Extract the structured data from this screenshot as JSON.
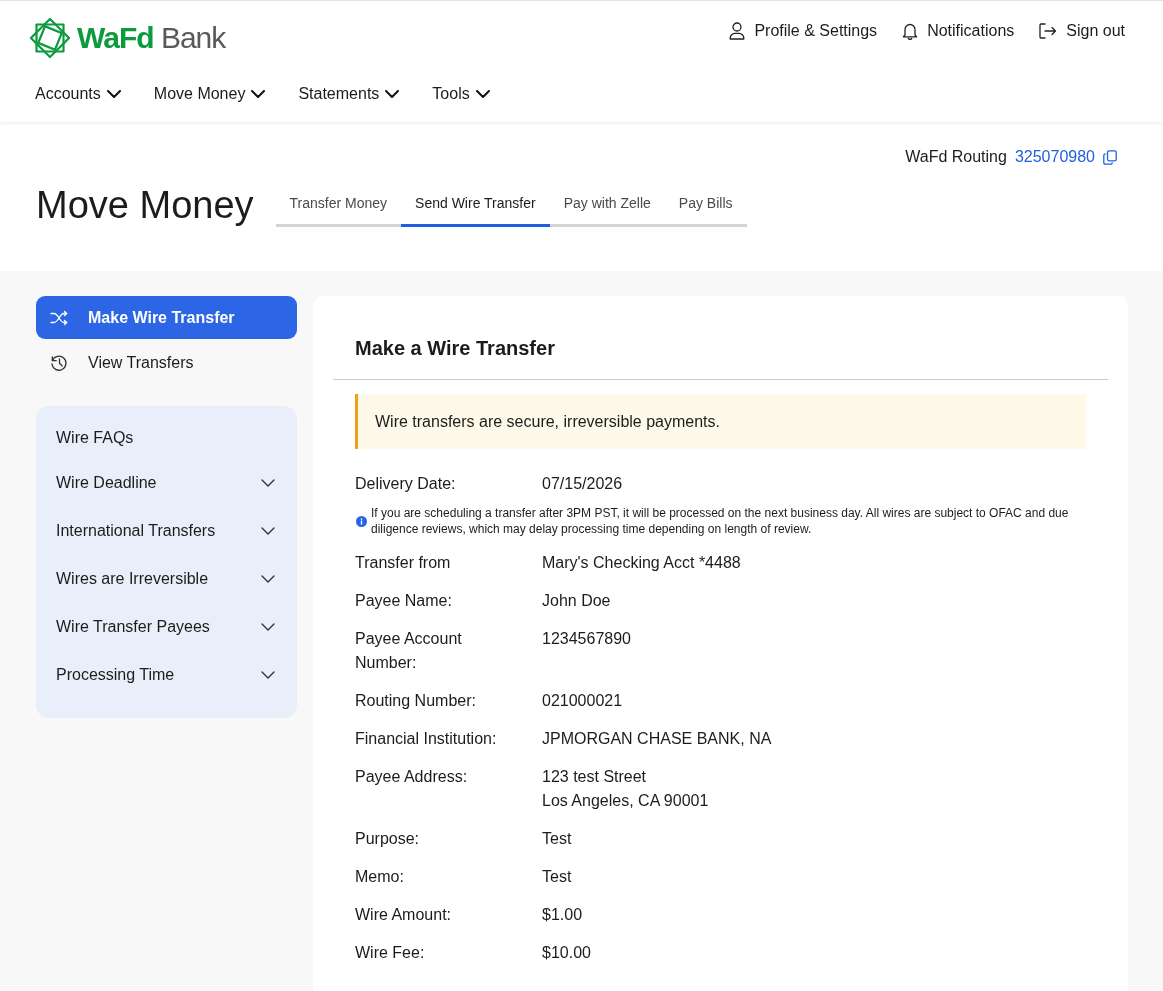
{
  "header": {
    "brand": "**WaFd** Bank",
    "links": [
      {
        "label": "Profile & Settings"
      },
      {
        "label": "Notifications"
      },
      {
        "label": "Sign out"
      }
    ],
    "nav": [
      {
        "label": "Accounts",
        "expanded": false
      },
      {
        "label": "Move Money",
        "expanded": false
      },
      {
        "label": "Statements",
        "expanded": false
      },
      {
        "label": "Tools",
        "expanded": false
      }
    ]
  },
  "routing": {
    "label": "WaFd Routing",
    "number": "325070980"
  },
  "page_title": "Move Money",
  "tabs": [
    {
      "label": "Transfer Money",
      "selected": false
    },
    {
      "label": "Send Wire Transfer",
      "selected": true
    },
    {
      "label": "Pay with Zelle",
      "selected": false
    },
    {
      "label": "Pay Bills",
      "selected": false
    }
  ],
  "sidebar": {
    "items": [
      {
        "label": "Make Wire Transfer",
        "selected": true
      },
      {
        "label": "View Transfers",
        "selected": false
      }
    ]
  },
  "faq": {
    "title": "Wire FAQs",
    "items": [
      {
        "label": "Wire Deadline",
        "expanded": false
      },
      {
        "label": "International Transfers",
        "expanded": false
      },
      {
        "label": "Wires are Irreversible",
        "expanded": false
      },
      {
        "label": "Wire Transfer Payees",
        "expanded": false
      },
      {
        "label": "Processing Time",
        "expanded": false
      }
    ]
  },
  "card": {
    "title": "Make a Wire Transfer",
    "alert": "Wire transfers are secure, irreversible payments.",
    "fields": [
      {
        "label": "Delivery Date:",
        "value": "07/15/2026",
        "note": "If you are scheduling a transfer after 3PM PST, it will be processed on the next business day. All wires are subject to OFAC and due diligence reviews, which may delay processing time depending on length of review."
      },
      {
        "label": "Transfer from",
        "value": "Mary's Checking Acct *4488"
      },
      {
        "label": "Payee Name:",
        "value": "John Doe"
      },
      {
        "label": "Payee Account Number:",
        "value": "1234567890"
      },
      {
        "label": "Routing Number:",
        "value": "021000021"
      },
      {
        "label": "Financial Institution:",
        "value": "JPMORGAN CHASE BANK, NA"
      },
      {
        "label": "Payee Address:",
        "value_lines": [
          "123 test Street",
          "Los Angeles, CA 90001"
        ]
      },
      {
        "label": "Purpose:",
        "value": "Test"
      },
      {
        "label": "Memo:",
        "value": "Test"
      },
      {
        "label": "Wire Amount:",
        "value": "$1.00"
      },
      {
        "label": "Wire Fee:",
        "value": "$10.00"
      }
    ]
  }
}
